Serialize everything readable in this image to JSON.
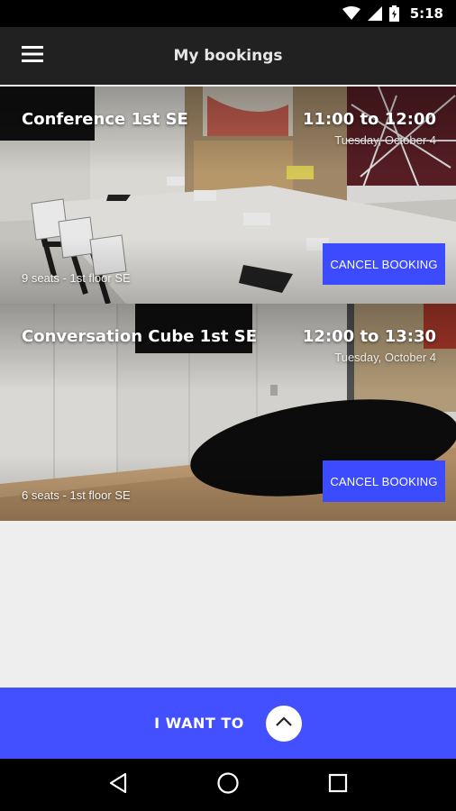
{
  "status_bar": {
    "time": "5:18",
    "icons": [
      "wifi-icon",
      "signal-icon",
      "battery-icon"
    ]
  },
  "app_bar": {
    "title": "My bookings",
    "menu_icon": "menu-icon"
  },
  "bookings": [
    {
      "room_name": "Conference 1st SE",
      "time_range": "11:00 to 12:00",
      "date": "Tuesday, October 4",
      "details": "9 seats - 1st floor SE",
      "cancel_label": "CANCEL BOOKING"
    },
    {
      "room_name": "Conversation Cube 1st SE",
      "time_range": "12:00 to 13:30",
      "date": "Tuesday, October 4",
      "details": "6 seats - 1st floor SE",
      "cancel_label": "CANCEL BOOKING"
    }
  ],
  "bottom_action": {
    "label": "I WANT TO",
    "icon": "chevron-up-icon"
  },
  "nav_bar": {
    "icons": [
      "back-icon",
      "home-icon",
      "recents-icon"
    ]
  },
  "colors": {
    "accent": "#4250ff",
    "button": "#3d4bff",
    "app_bar": "#212121",
    "content_bg": "#eeeeee"
  }
}
